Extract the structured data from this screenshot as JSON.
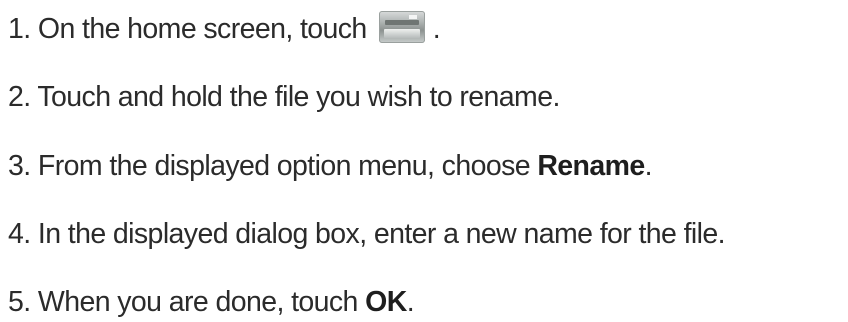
{
  "steps": [
    {
      "number": "1.",
      "text_before": "On the home screen, touch",
      "icon": "file-manager-app-icon",
      "text_after": "."
    },
    {
      "number": "2.",
      "text": "Touch and hold the file you wish to rename."
    },
    {
      "number": "3.",
      "text_before": "From the displayed option menu, choose ",
      "bold": "Rename",
      "text_after": "."
    },
    {
      "number": "4.",
      "text": "In the displayed dialog box, enter a new name for the file."
    },
    {
      "number": "5.",
      "text_before": "When you are done, touch ",
      "bold": "OK",
      "text_after": "."
    }
  ]
}
